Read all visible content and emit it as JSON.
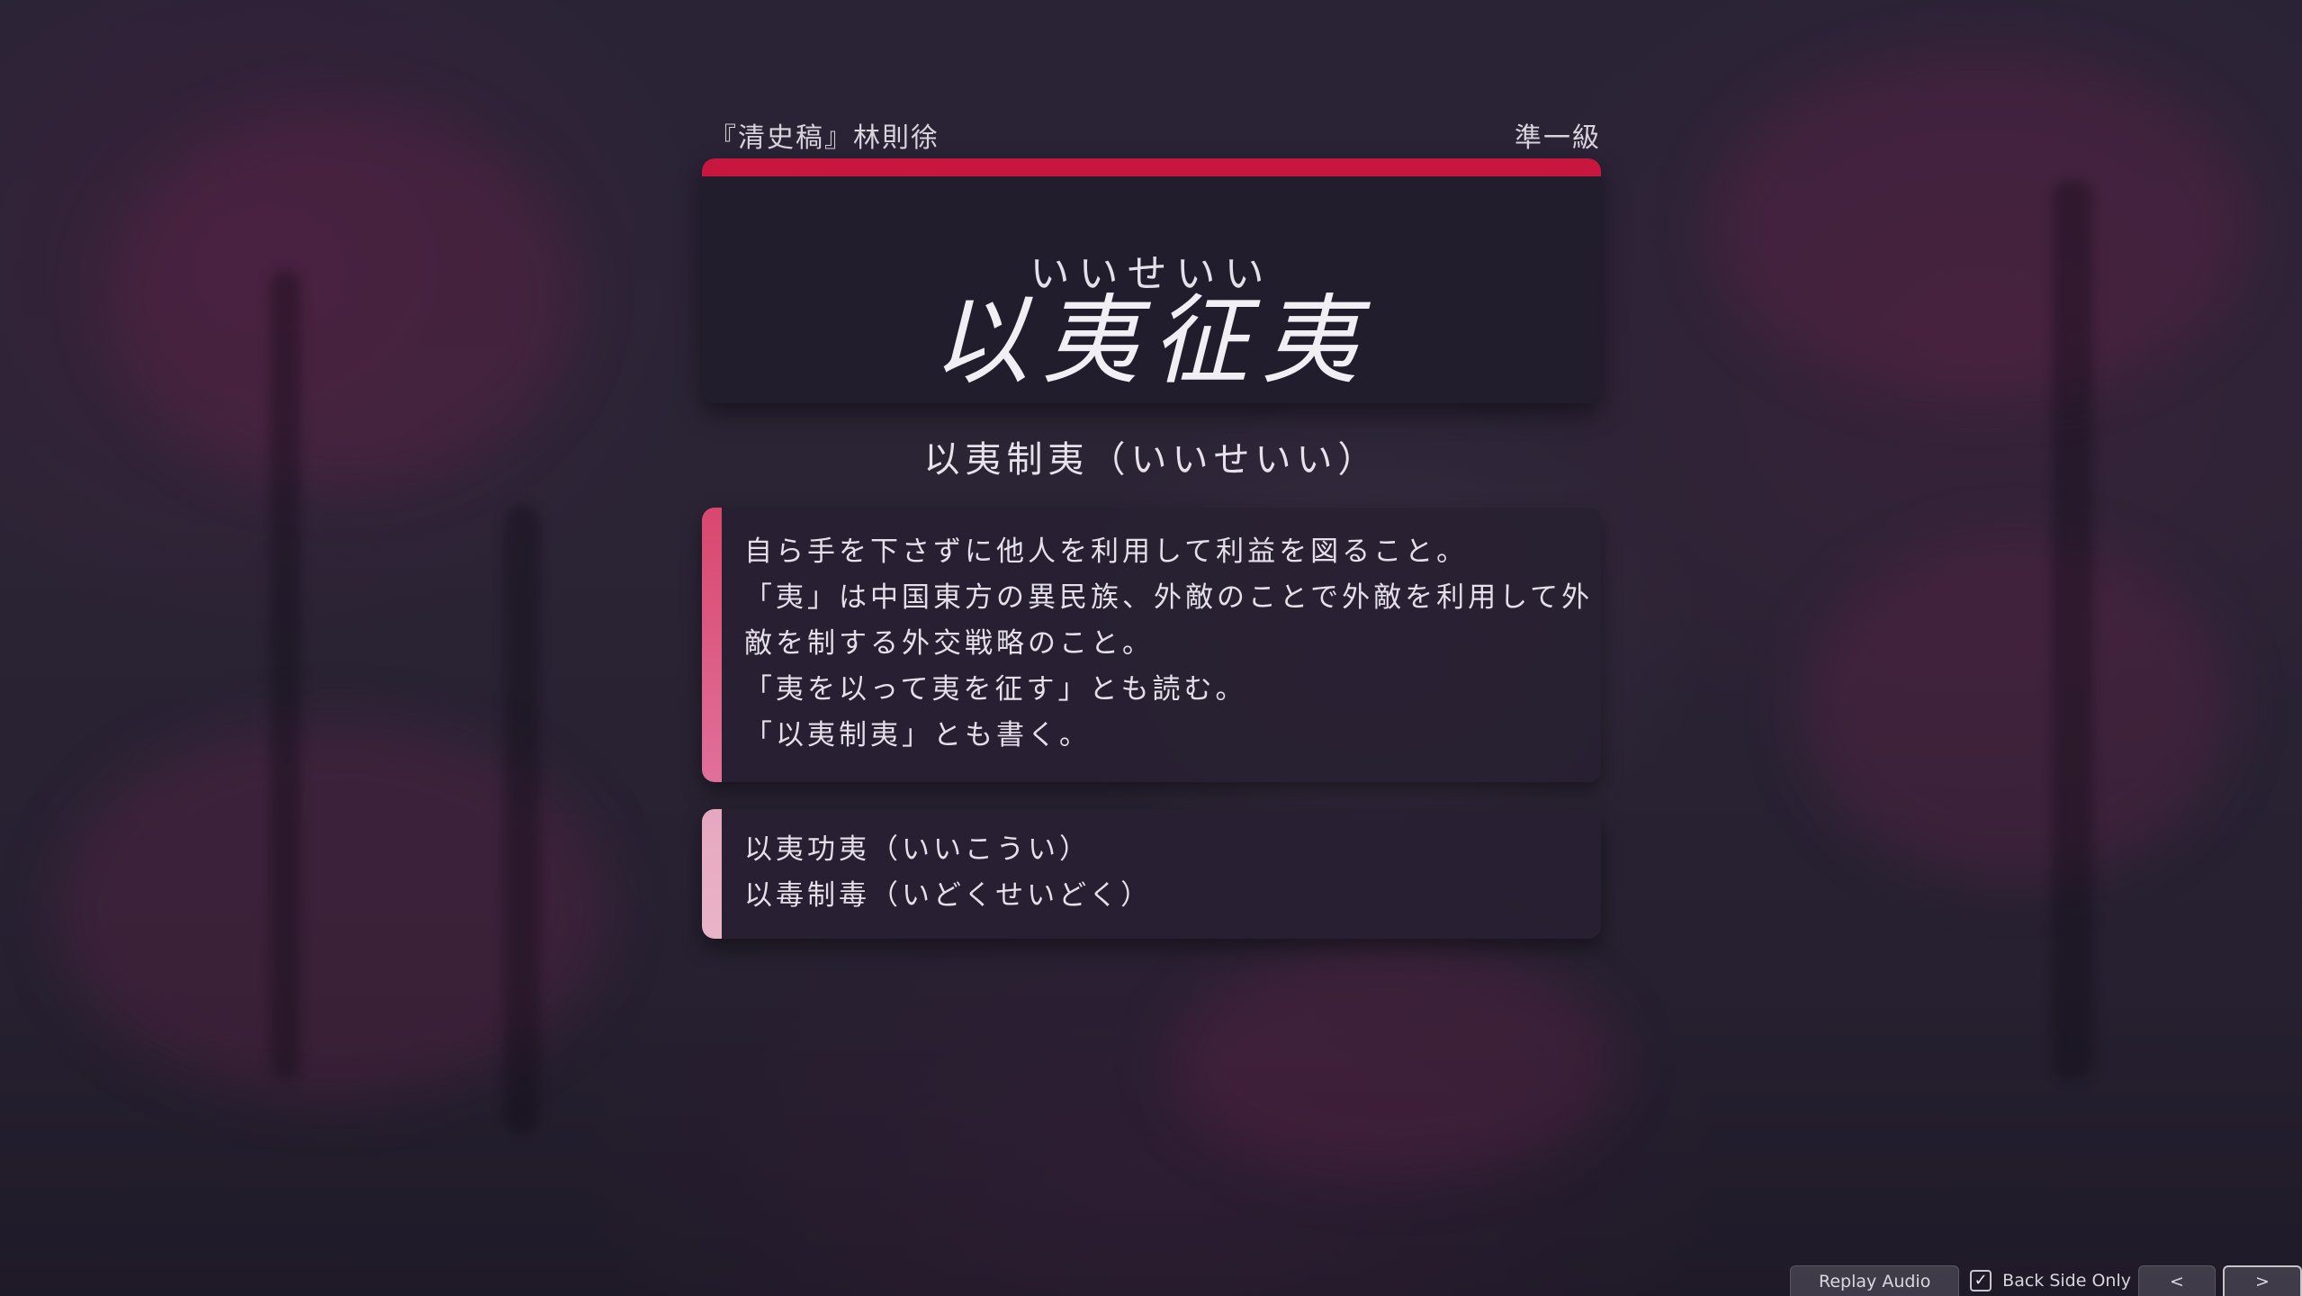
{
  "header": {
    "source": "『清史稿』林則徐",
    "grade": "準一級"
  },
  "front": {
    "reading": "いいせいい",
    "idiom": "以夷征夷"
  },
  "answer": {
    "line": "以夷制夷（いいせいい）"
  },
  "meaning": {
    "lines": [
      "自ら手を下さずに他人を利用して利益を図ること。",
      "「夷」は中国東方の異民族、外敵のことで外敵を利用して外",
      "敵を制する外交戦略のこと。",
      "「夷を以って夷を征す」とも読む。",
      "「以夷制夷」とも書く。"
    ]
  },
  "related": {
    "lines": [
      "以夷功夷（いいこうい）",
      "以毒制毒（いどくせいどく）"
    ]
  },
  "toolbar": {
    "replay_label": "Replay Audio",
    "back_side_label": "Back Side Only",
    "back_side_checked": true,
    "prev_label": "<",
    "next_label": ">"
  },
  "colors": {
    "accent": "#c8173f",
    "meaning_bar": "#d9476e",
    "related_bar": "#e6a7bf",
    "card_bg": "#221d2c"
  }
}
